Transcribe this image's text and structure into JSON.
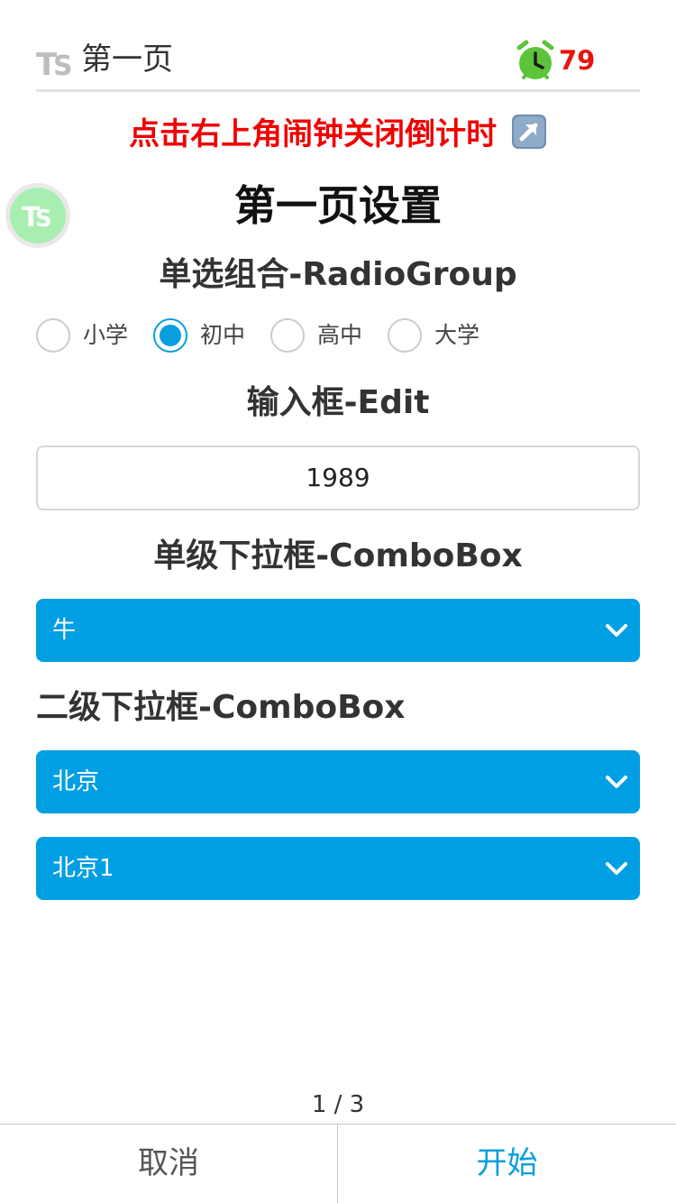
{
  "header": {
    "title": "第一页",
    "countdown": "79"
  },
  "hint": {
    "text": "点击右上角闹钟关闭倒计时"
  },
  "heading": "第一页设置",
  "radio_group": {
    "title": "单选组合-RadioGroup",
    "options": [
      "小学",
      "初中",
      "高中",
      "大学"
    ],
    "selected": "初中"
  },
  "edit": {
    "title": "输入框-Edit",
    "value": "1989"
  },
  "combo_single": {
    "title": "单级下拉框-ComboBox",
    "value": "牛"
  },
  "combo_two_level": {
    "title": "二级下拉框-ComboBox",
    "level1_value": "北京",
    "level2_value": "北京1"
  },
  "pager": {
    "indicator": "1 / 3"
  },
  "footer": {
    "cancel_label": "取消",
    "start_label": "开始"
  },
  "colors": {
    "accent": "#009fe3",
    "alert": "#f00000",
    "alarm_green": "#5cc43a"
  },
  "icons": {
    "logo": "ts-logo-icon",
    "alarm": "alarm-clock-icon",
    "arrow": "arrow-up-right-icon",
    "chevron": "chevron-down-icon"
  }
}
